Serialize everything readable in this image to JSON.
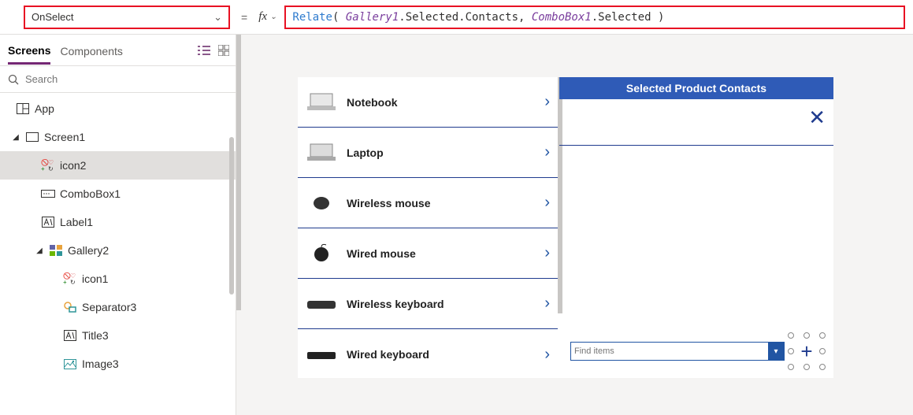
{
  "formula_bar": {
    "property": "OnSelect",
    "equals": "=",
    "fx": "fx",
    "fn": "Relate",
    "obj1": "Gallery1",
    "part1": ".Selected.Contacts, ",
    "obj2": "ComboBox1",
    "part2": ".Selected )"
  },
  "tabs": {
    "screens": "Screens",
    "components": "Components"
  },
  "search": {
    "placeholder": "Search"
  },
  "tree": {
    "app": "App",
    "screen1": "Screen1",
    "icon2": "icon2",
    "combobox1": "ComboBox1",
    "label1": "Label1",
    "gallery2": "Gallery2",
    "icon1": "icon1",
    "separator3": "Separator3",
    "title3": "Title3",
    "image3": "Image3"
  },
  "gallery": {
    "items": [
      {
        "label": "Notebook"
      },
      {
        "label": "Laptop"
      },
      {
        "label": "Wireless mouse"
      },
      {
        "label": "Wired mouse"
      },
      {
        "label": "Wireless keyboard"
      },
      {
        "label": "Wired keyboard"
      }
    ]
  },
  "rightcol": {
    "header": "Selected Product Contacts",
    "combo_placeholder": "Find items"
  }
}
